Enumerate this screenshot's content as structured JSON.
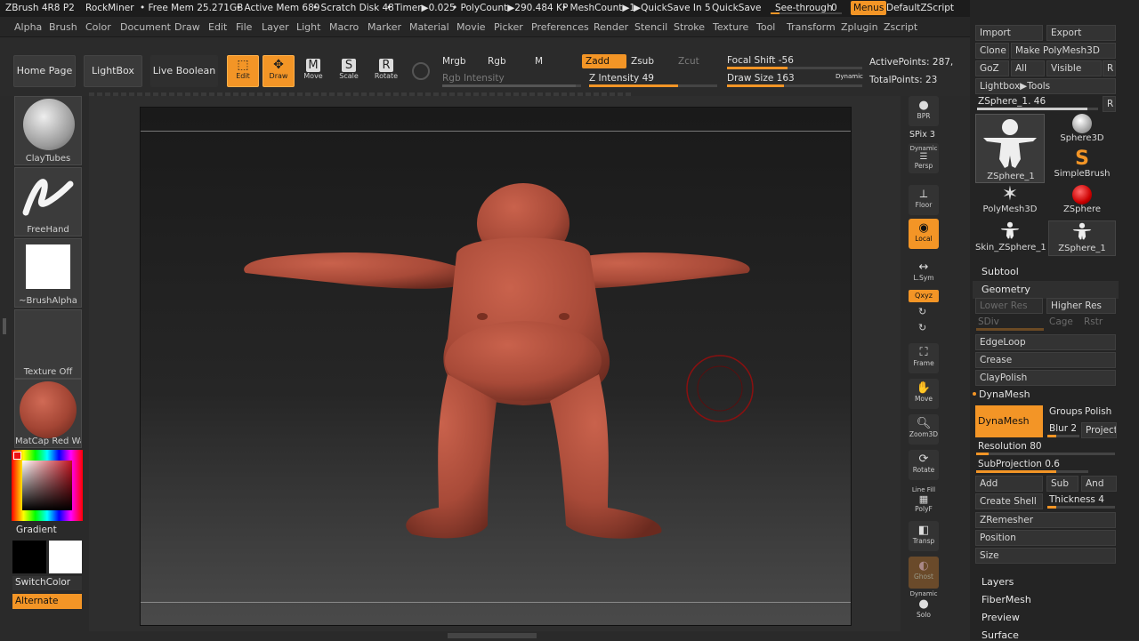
{
  "titlebar": {
    "app": "ZBrush 4R8 P2",
    "project": "RockMiner",
    "free_mem": "• Free Mem 25.271GB",
    "active_mem": "• Active Mem 689",
    "scratch": "• Scratch Disk 48",
    "timer": "• Timer▶0.025",
    "polycount": "• PolyCount▶290.484 KP",
    "meshcount": "• MeshCount▶1",
    "quicksave_in": "▶QuickSave In 5",
    "quicksave": "QuickSave",
    "see_through": "See-through",
    "see_through_val": "0",
    "menus": "Menus",
    "zscript": "DefaultZScript"
  },
  "menubar": [
    "Alpha",
    "Brush",
    "Color",
    "Document",
    "Draw",
    "Edit",
    "File",
    "Layer",
    "Light",
    "Macro",
    "Marker",
    "Material",
    "Movie",
    "Picker",
    "Preferences",
    "Render",
    "Stencil",
    "Stroke",
    "Texture",
    "Tool",
    "Transform",
    "Zplugin",
    "Zscript"
  ],
  "shelf": {
    "home": "Home Page",
    "lightbox": "LightBox",
    "liveboolean": "Live Boolean",
    "edit": "Edit",
    "draw": "Draw",
    "move": "Move",
    "scale": "Scale",
    "rotate": "Rotate",
    "mrgb": "Mrgb",
    "rgb": "Rgb",
    "m": "M",
    "zadd": "Zadd",
    "zsub": "Zsub",
    "zcut": "Zcut",
    "rgb_intensity": "Rgb Intensity",
    "z_intensity": "Z Intensity 49",
    "focal_shift": "Focal Shift -56",
    "draw_size": "Draw Size 163",
    "dynamic": "Dynamic",
    "active_points": "ActivePoints: 287,",
    "total_points": "TotalPoints: 23"
  },
  "left": {
    "brush": "ClayTubes",
    "stroke": "FreeHand",
    "alpha": "~BrushAlpha",
    "texture": "Texture Off",
    "material": "MatCap Red Wax",
    "gradient": "Gradient",
    "switchcolor": "SwitchColor",
    "alternate": "Alternate"
  },
  "right": {
    "bpr": "BPR",
    "spix": "SPix 3",
    "dynamic": "Dynamic",
    "persp": "Persp",
    "floor": "Floor",
    "local": "Local",
    "lsym": "L.Sym",
    "xyz": "Qxyz",
    "frame": "Frame",
    "move": "Move",
    "zoom3d": "Zoom3D",
    "rotate": "Rotate",
    "linefill": "Line Fill",
    "polyf": "PolyF",
    "transp": "Transp",
    "ghost": "Ghost",
    "dynamic2": "Dynamic",
    "solo": "Solo"
  },
  "tray": {
    "import": "Import",
    "export": "Export",
    "clone": "Clone",
    "make_polymesh": "Make PolyMesh3D",
    "goz": "GoZ",
    "all": "All",
    "visible": "Visible",
    "r": "R",
    "lightbox_tools": "Lightbox▶Tools",
    "zsphere_slider": "ZSphere_1. 46",
    "r2": "R",
    "tools": [
      {
        "name": "ZSphere_1",
        "icon": "figure-icon"
      },
      {
        "name": "Sphere3D",
        "icon": "sphere-icon"
      },
      {
        "name": "SimpleBrush",
        "icon": "simplebrush-icon"
      },
      {
        "name": "PolyMesh3D",
        "icon": "star-icon"
      },
      {
        "name": "ZSphere",
        "icon": "zsphere-icon"
      },
      {
        "name": "Skin_ZSphere_1",
        "icon": "figure-icon"
      },
      {
        "name": "ZSphere_1",
        "icon": "figure-icon"
      }
    ],
    "subtool": "Subtool",
    "geometry": "Geometry",
    "lower_res": "Lower Res",
    "higher_res": "Higher Res",
    "sdiv": "SDiv",
    "cage": "Cage",
    "rstr": "Rstr",
    "edgeloop": "EdgeLoop",
    "crease": "Crease",
    "claypolish": "ClayPolish",
    "dynamesh_header": "DynaMesh",
    "dynamesh_btn": "DynaMesh",
    "groups": "Groups",
    "polish": "Polish",
    "blur": "Blur 2",
    "project": "Project",
    "resolution": "Resolution 80",
    "subprojection": "SubProjection 0.6",
    "add": "Add",
    "sub": "Sub",
    "and": "And",
    "create_shell": "Create Shell",
    "thickness": "Thickness 4",
    "zremesher": "ZRemesher",
    "position": "Position",
    "size": "Size",
    "layers": "Layers",
    "fibermesh": "FiberMesh",
    "preview": "Preview",
    "surface": "Surface"
  },
  "colors": {
    "accent": "#f39526",
    "model": "#a84a38",
    "background": "#2a2a2a"
  }
}
